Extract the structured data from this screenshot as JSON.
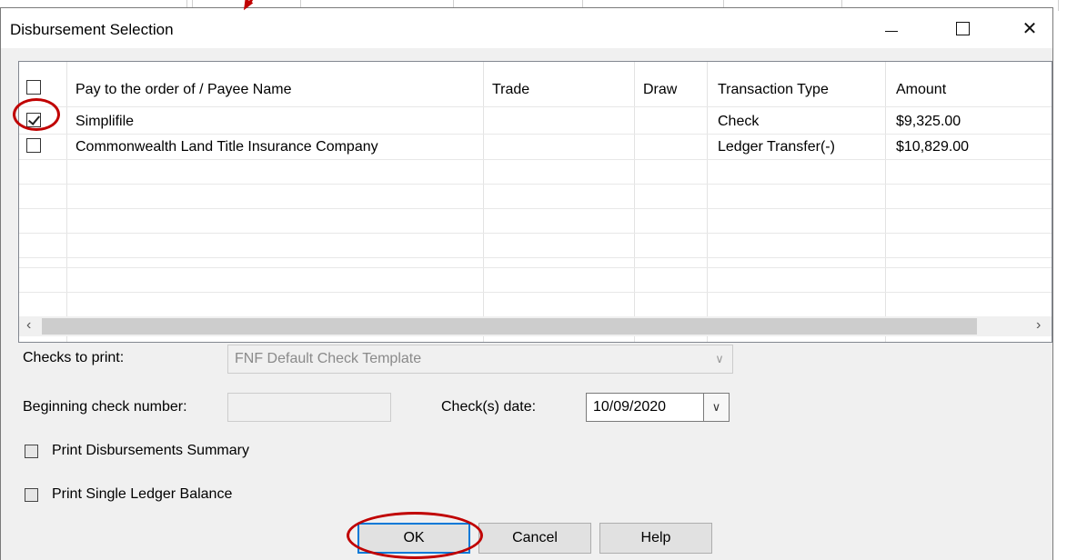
{
  "dialog": {
    "title": "Disbursement Selection",
    "colors": {
      "annotation": "#c00000",
      "accent": "#0078d7"
    }
  },
  "grid": {
    "columns": [
      "Pay to the order of / Payee Name",
      "Trade",
      "Draw",
      "Transaction Type",
      "Amount"
    ],
    "rows": [
      {
        "checked": true,
        "payee": "Simplifile",
        "trade": "",
        "draw": "",
        "type": "Check",
        "amount": "$9,325.00"
      },
      {
        "checked": false,
        "payee": "Commonwealth Land Title Insurance Company",
        "trade": "",
        "draw": "",
        "type": "Ledger Transfer(-)",
        "amount": "$10,829.00"
      }
    ],
    "scroll_left_icon": "chevron-left-icon",
    "scroll_right_icon": "chevron-right-icon"
  },
  "form": {
    "checks_to_print_label": "Checks to print:",
    "checks_to_print_value": "FNF Default Check Template",
    "beginning_check_label": "Beginning check number:",
    "beginning_check_value": "",
    "check_date_label": "Check(s) date:",
    "check_date_value": "10/09/2020",
    "print_summary_label": "Print Disbursements Summary",
    "print_single_ledger_label": "Print Single Ledger Balance"
  },
  "buttons": {
    "ok": "OK",
    "cancel": "Cancel",
    "help": "Help"
  }
}
